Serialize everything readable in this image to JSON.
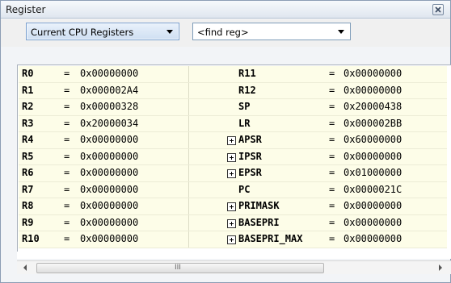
{
  "window": {
    "title": "Register"
  },
  "toolbar": {
    "register_set": "Current CPU Registers",
    "find_reg": "<find reg>"
  },
  "registers": [
    {
      "left": {
        "name": "R0",
        "eq": "=",
        "value": "0x00000000"
      },
      "right": {
        "name": "R11",
        "eq": "=",
        "value": "0x00000000",
        "expandable": false
      }
    },
    {
      "left": {
        "name": "R1",
        "eq": "=",
        "value": "0x000002A4"
      },
      "right": {
        "name": "R12",
        "eq": "=",
        "value": "0x00000000",
        "expandable": false
      }
    },
    {
      "left": {
        "name": "R2",
        "eq": "=",
        "value": "0x00000328"
      },
      "right": {
        "name": "SP",
        "eq": "=",
        "value": "0x20000438",
        "expandable": false
      }
    },
    {
      "left": {
        "name": "R3",
        "eq": "=",
        "value": "0x20000034"
      },
      "right": {
        "name": "LR",
        "eq": "=",
        "value": "0x000002BB",
        "expandable": false
      }
    },
    {
      "left": {
        "name": "R4",
        "eq": "=",
        "value": "0x00000000"
      },
      "right": {
        "name": "APSR",
        "eq": "=",
        "value": "0x60000000",
        "expandable": true
      }
    },
    {
      "left": {
        "name": "R5",
        "eq": "=",
        "value": "0x00000000"
      },
      "right": {
        "name": "IPSR",
        "eq": "=",
        "value": "0x00000000",
        "expandable": true
      }
    },
    {
      "left": {
        "name": "R6",
        "eq": "=",
        "value": "0x00000000"
      },
      "right": {
        "name": "EPSR",
        "eq": "=",
        "value": "0x01000000",
        "expandable": true
      }
    },
    {
      "left": {
        "name": "R7",
        "eq": "=",
        "value": "0x00000000"
      },
      "right": {
        "name": "PC",
        "eq": "=",
        "value": "0x0000021C",
        "expandable": false
      }
    },
    {
      "left": {
        "name": "R8",
        "eq": "=",
        "value": "0x00000000"
      },
      "right": {
        "name": "PRIMASK",
        "eq": "=",
        "value": "0x00000000",
        "expandable": true
      }
    },
    {
      "left": {
        "name": "R9",
        "eq": "=",
        "value": "0x00000000"
      },
      "right": {
        "name": "BASEPRI",
        "eq": "=",
        "value": "0x00000000",
        "expandable": true
      }
    },
    {
      "left": {
        "name": "R10",
        "eq": "=",
        "value": "0x00000000"
      },
      "right": {
        "name": "BASEPRI_MAX",
        "eq": "=",
        "value": "0x00000000",
        "expandable": true
      }
    }
  ],
  "scrollbar": {
    "grip": "III"
  }
}
